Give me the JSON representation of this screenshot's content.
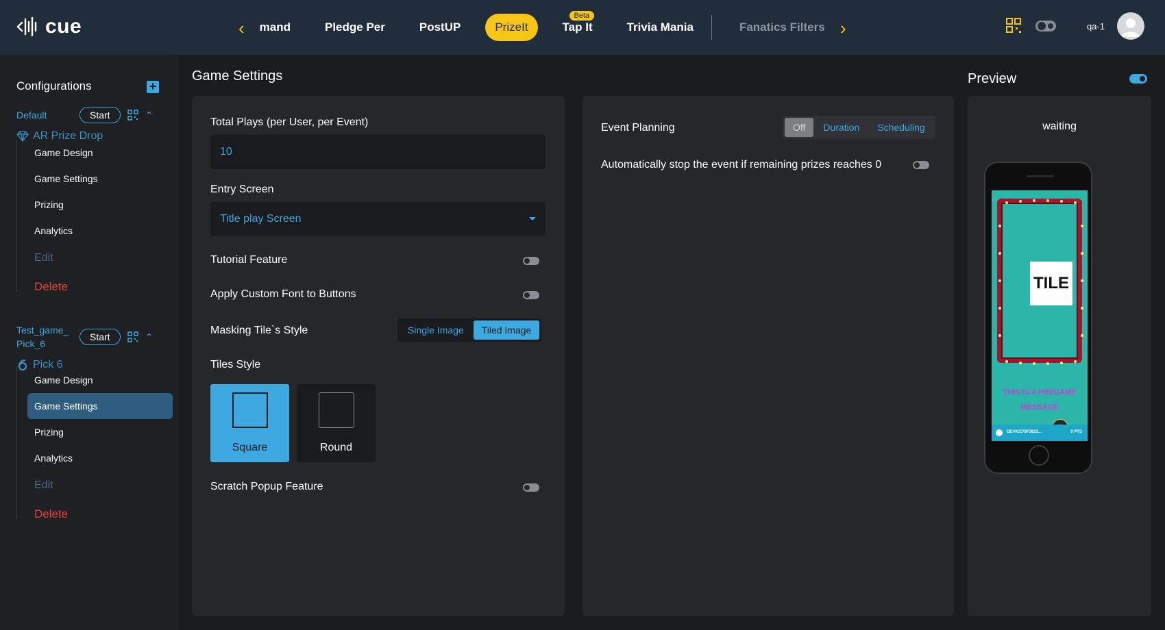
{
  "app": {
    "logo_text": "cue"
  },
  "nav": {
    "tabs": [
      {
        "label": "Demand"
      },
      {
        "label": "Pledge Per"
      },
      {
        "label": "PostUP"
      },
      {
        "label": "PrizeIt"
      },
      {
        "label": "Tap It",
        "badge": "Beta"
      },
      {
        "label": "Trivia Mania"
      },
      {
        "label": "Fanatics Filters"
      }
    ],
    "user": "qa-1"
  },
  "sidebar": {
    "title": "Configurations",
    "configs": [
      {
        "name": "Default",
        "start_label": "Start",
        "game": "AR Prize Drop",
        "items": [
          "Game Design",
          "Game Settings",
          "Prizing",
          "Analytics",
          "Edit",
          "Delete"
        ]
      },
      {
        "name_line1": "Test_game_",
        "name_line2": "Pick_6",
        "start_label": "Start",
        "game": "Pick 6",
        "items": [
          "Game Design",
          "Game Settings",
          "Prizing",
          "Analytics",
          "Edit",
          "Delete"
        ]
      }
    ]
  },
  "main": {
    "title": "Game Settings",
    "total_plays_label": "Total Plays (per User, per Event)",
    "total_plays_value": "10",
    "entry_screen_label": "Entry Screen",
    "entry_screen_value": "Title play Screen",
    "tutorial_label": "Tutorial Feature",
    "custom_font_label": "Apply Custom Font to Buttons",
    "masking_label": "Masking Tile`s Style",
    "masking_options": [
      "Single Image",
      "Tiled Image"
    ],
    "tiles_style_label": "Tiles Style",
    "tiles_options": [
      "Square",
      "Round"
    ],
    "scratch_label": "Scratch Popup Feature"
  },
  "event": {
    "planning_label": "Event Planning",
    "planning_options": [
      "Off",
      "Duration",
      "Scheduling"
    ],
    "auto_stop_label": "Automatically stop the event if remaining prizes reaches 0"
  },
  "preview": {
    "title": "Preview",
    "status": "waiting",
    "tile_text": "TILE",
    "pregame_message": "THIS IS A PREGAME MESSAGE",
    "bar_left": "DEVICE76F3823...",
    "bar_right": "0 PTS"
  },
  "colors": {
    "accent": "#3da9e0",
    "brand_yellow": "#f5c518",
    "danger": "#e8433c"
  }
}
